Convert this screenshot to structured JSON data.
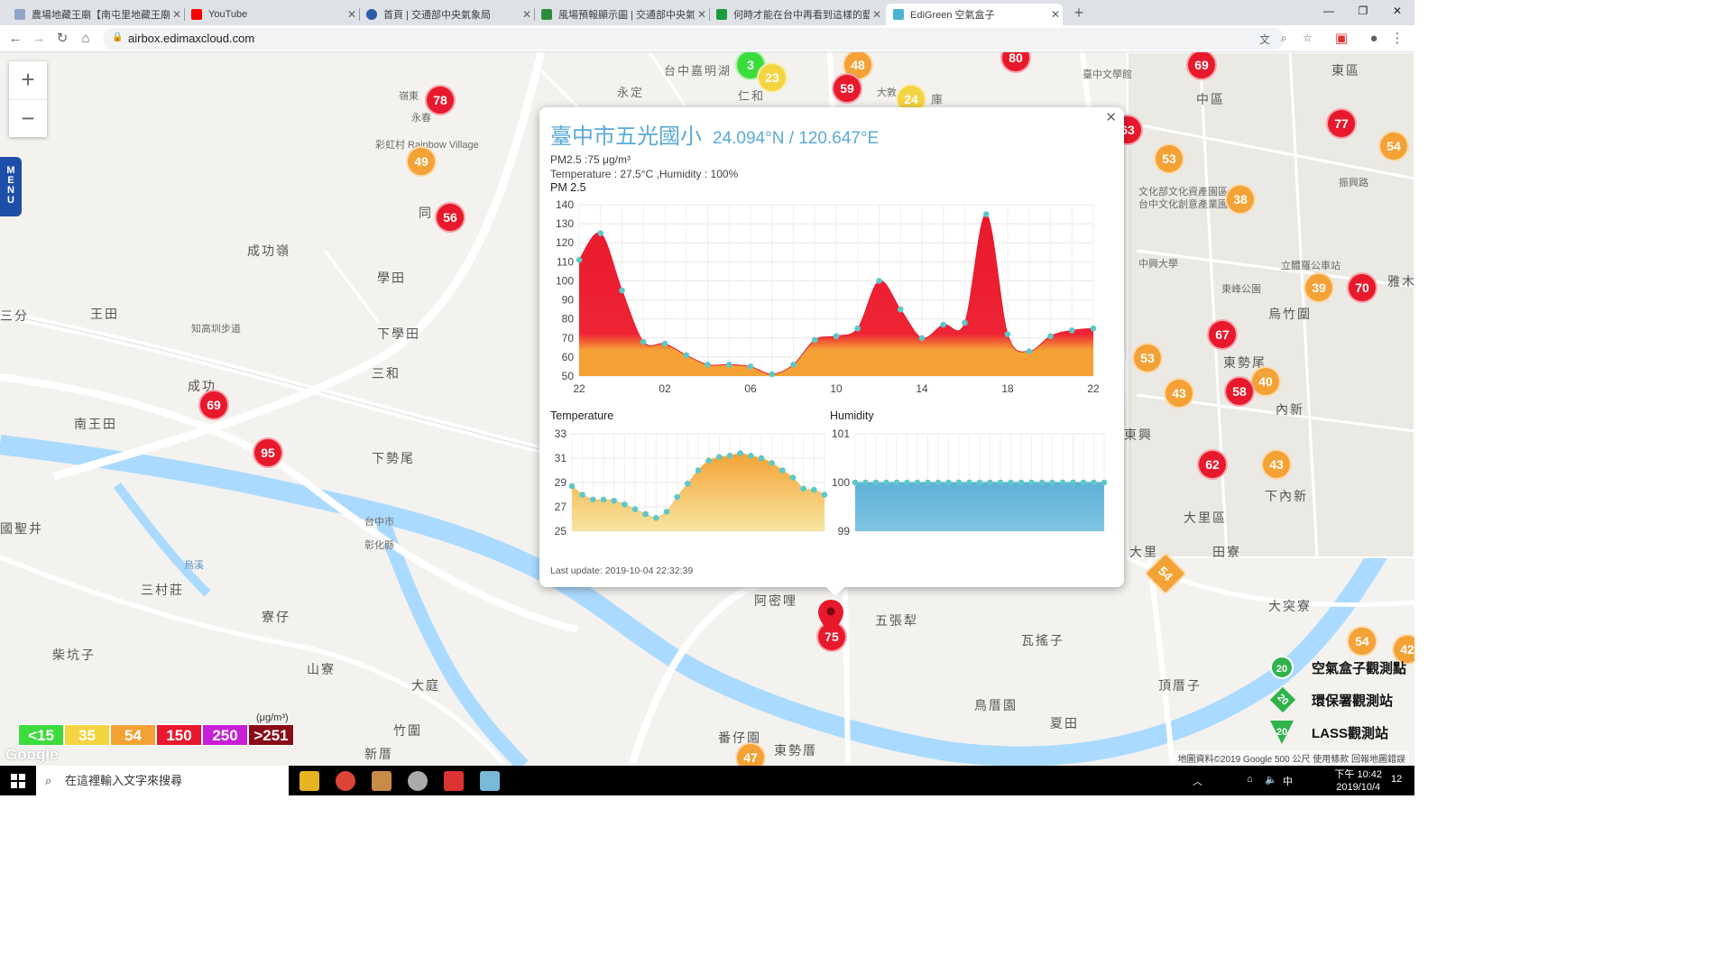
{
  "browser": {
    "tabs": [
      {
        "title": "農場地藏王廟【南屯里地藏王廟】"
      },
      {
        "title": "YouTube"
      },
      {
        "title": "首頁 | 交通部中央氣象局"
      },
      {
        "title": "風場預報顯示圖 | 交通部中央氣象局"
      },
      {
        "title": "何時才能在台中再看到這樣的藍天"
      },
      {
        "title": "EdiGreen 空氣盒子"
      }
    ],
    "url": "airbox.edimaxcloud.com"
  },
  "map": {
    "menu_label": "MENU",
    "labels": [
      {
        "t": "台中嘉明湖"
      },
      {
        "t": "永定"
      },
      {
        "t": "仁和"
      },
      {
        "t": "大敦"
      },
      {
        "t": "庫"
      },
      {
        "t": "臺中文學館"
      },
      {
        "t": "中區"
      },
      {
        "t": "東區"
      },
      {
        "t": "嶺東"
      },
      {
        "t": "彩虹村 Rainbow Village"
      },
      {
        "t": "永春"
      },
      {
        "t": "成功嶺"
      },
      {
        "t": "學田"
      },
      {
        "t": "同"
      },
      {
        "t": "王田"
      },
      {
        "t": "知高圳步道"
      },
      {
        "t": "下學田"
      },
      {
        "t": "三和"
      },
      {
        "t": "成功"
      },
      {
        "t": "南王田"
      },
      {
        "t": "下勢尾"
      },
      {
        "t": "台中市"
      },
      {
        "t": "彰化縣"
      },
      {
        "t": "烏溪"
      },
      {
        "t": "三村莊"
      },
      {
        "t": "寮仔"
      },
      {
        "t": "山寮"
      },
      {
        "t": "大庭"
      },
      {
        "t": "竹圍"
      },
      {
        "t": "新厝"
      },
      {
        "t": "柴坑子"
      },
      {
        "t": "番仔園"
      },
      {
        "t": "東勢厝"
      },
      {
        "t": "阿密哩"
      },
      {
        "t": "五張犁"
      },
      {
        "t": "瓦搖子"
      },
      {
        "t": "大里區"
      },
      {
        "t": "頂厝子"
      },
      {
        "t": "鳥厝園"
      },
      {
        "t": "夏田"
      },
      {
        "t": "大突寮"
      },
      {
        "t": "田寮"
      },
      {
        "t": "下內新"
      },
      {
        "t": "內新"
      },
      {
        "t": "東興"
      },
      {
        "t": "烏竹圍"
      },
      {
        "t": "東勢尾"
      },
      {
        "t": "東峰公園"
      },
      {
        "t": "文化部文化資產園區"
      },
      {
        "t": "台中文化創意產業園區"
      },
      {
        "t": "振興路"
      },
      {
        "t": "雅木"
      },
      {
        "t": "立體羅公車站"
      },
      {
        "t": "中興大學"
      },
      {
        "t": "大里"
      },
      {
        "t": "國聖井"
      },
      {
        "t": "三分"
      }
    ],
    "markers": [
      {
        "v": "3",
        "c": "#3ddc3d"
      },
      {
        "v": "23",
        "c": "#f5d442"
      },
      {
        "v": "48",
        "c": "#f4a236"
      },
      {
        "v": "59",
        "c": "#e8192c"
      },
      {
        "v": "24",
        "c": "#f5d442"
      },
      {
        "v": "80",
        "c": "#e8192c"
      },
      {
        "v": "69",
        "c": "#e8192c"
      },
      {
        "v": "78",
        "c": "#e8192c"
      },
      {
        "v": "49",
        "c": "#f4a236"
      },
      {
        "v": "56",
        "c": "#e8192c"
      },
      {
        "v": "63",
        "c": "#e8192c"
      },
      {
        "v": "53",
        "c": "#f4a236"
      },
      {
        "v": "77",
        "c": "#e8192c"
      },
      {
        "v": "54",
        "c": "#f4a236"
      },
      {
        "v": "38",
        "c": "#f4a236"
      },
      {
        "v": "39",
        "c": "#f4a236"
      },
      {
        "v": "70",
        "c": "#e8192c"
      },
      {
        "v": "67",
        "c": "#e8192c"
      },
      {
        "v": "53",
        "c": "#f4a236"
      },
      {
        "v": "40",
        "c": "#f4a236"
      },
      {
        "v": "43",
        "c": "#f4a236"
      },
      {
        "v": "58",
        "c": "#e8192c"
      },
      {
        "v": "62",
        "c": "#e8192c"
      },
      {
        "v": "43",
        "c": "#f4a236"
      },
      {
        "v": "54",
        "c": "#f4a236"
      },
      {
        "v": "69",
        "c": "#e8192c"
      },
      {
        "v": "95",
        "c": "#e8192c"
      },
      {
        "v": "75",
        "c": "#e8192c"
      },
      {
        "v": "54",
        "c": "#f4a236"
      },
      {
        "v": "47",
        "c": "#f4a236"
      },
      {
        "v": "42",
        "c": "#f4a236"
      }
    ],
    "legend": {
      "unit": "(μg/m³)",
      "cells": [
        {
          "label": "<15",
          "color": "#3ddc3d"
        },
        {
          "label": "35",
          "color": "#f5d442"
        },
        {
          "label": "54",
          "color": "#f4a236"
        },
        {
          "label": "150",
          "color": "#e8192c"
        },
        {
          "label": "250",
          "color": "#c81fd8"
        },
        {
          "label": ">251",
          "color": "#8a0b17"
        }
      ]
    },
    "stations": [
      {
        "label": "空氣盒子觀測點",
        "badge": "20"
      },
      {
        "label": "環保署觀測站",
        "badge": "20"
      },
      {
        "label": "LASS觀測站",
        "badge": "20"
      }
    ],
    "google": "Google",
    "copyright": "地圖資料©2019 Google   500 公尺   使用條款   回報地圖錯誤"
  },
  "popup": {
    "title": "臺中市五光國小",
    "coord": "24.094°N / 120.647°E",
    "pm_line": "PM2.5 :75 μg/m³",
    "temp_line": "Temperature : 27.5°C ,Humidity : 100%",
    "pm_title": "PM 2.5",
    "temp_title": "Temperature",
    "hum_title": "Humidity",
    "last_update": "Last update: 2019-10-04 22:32:39"
  },
  "chart_data": [
    {
      "type": "area",
      "title": "PM 2.5",
      "xlabel": "",
      "ylabel": "",
      "ylim": [
        50,
        140
      ],
      "x_ticks": [
        "22",
        "02",
        "06",
        "10",
        "14",
        "18",
        "22"
      ],
      "y_ticks": [
        50,
        60,
        70,
        80,
        90,
        100,
        110,
        120,
        130,
        140
      ],
      "series": [
        {
          "values": [
            111,
            125,
            95,
            68,
            67,
            61,
            56,
            56,
            55,
            51,
            56,
            69,
            71,
            75,
            100,
            85,
            70,
            77,
            78,
            135,
            72,
            63,
            71,
            74,
            75
          ]
        }
      ]
    },
    {
      "type": "area",
      "title": "Temperature",
      "ylim": [
        25,
        33
      ],
      "y_ticks": [
        25,
        27,
        29,
        31,
        33
      ],
      "series": [
        {
          "values": [
            28.7,
            28.0,
            27.6,
            27.6,
            27.5,
            27.2,
            26.8,
            26.4,
            26.1,
            26.6,
            27.8,
            28.9,
            30.0,
            30.8,
            31.1,
            31.2,
            31.4,
            31.2,
            31.0,
            30.6,
            30.0,
            29.4,
            28.5,
            28.4,
            28.0
          ]
        }
      ]
    },
    {
      "type": "area",
      "title": "Humidity",
      "ylim": [
        99,
        101
      ],
      "y_ticks": [
        99,
        100,
        101
      ],
      "series": [
        {
          "values": [
            100,
            100,
            100,
            100,
            100,
            100,
            100,
            100,
            100,
            100,
            100,
            100,
            100,
            100,
            100,
            100,
            100,
            100,
            100,
            100,
            100,
            100,
            100,
            100,
            100
          ]
        }
      ]
    }
  ],
  "taskbar": {
    "search_placeholder": "在這裡輸入文字來搜尋",
    "time": "下午 10:42",
    "date": "2019/10/4",
    "ime": "中",
    "notify": "12"
  }
}
